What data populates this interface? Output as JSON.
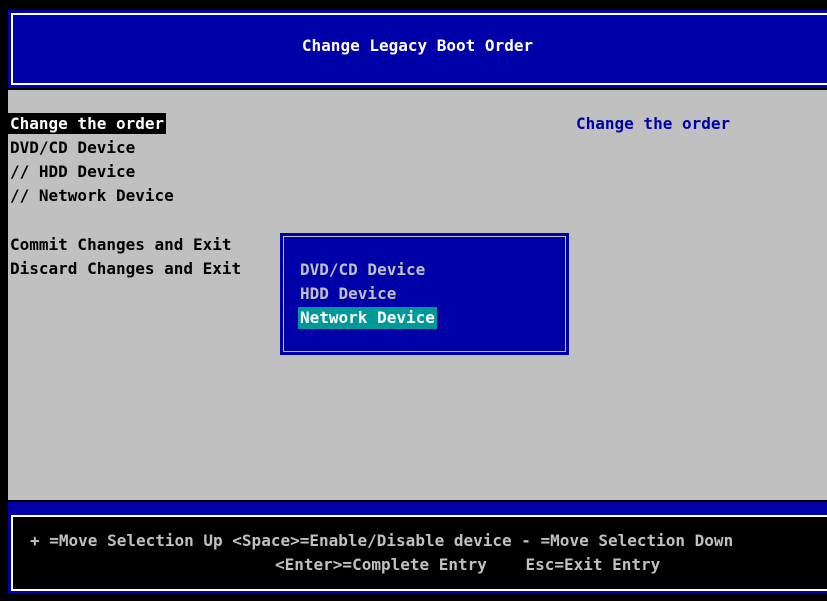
{
  "title": "Change Legacy Boot Order",
  "menu": {
    "change_order": "Change the order",
    "device_list": [
      "DVD/CD Device",
      "// HDD Device",
      "// Network Device"
    ],
    "commit": "Commit Changes and Exit",
    "discard": "Discard Changes and Exit"
  },
  "help_text": "Change the order",
  "popup": {
    "items": [
      "DVD/CD Device",
      "HDD Device",
      "Network Device"
    ],
    "selected_index": 2
  },
  "footer": {
    "line1": "+ =Move Selection Up <Space>=Enable/Disable device - =Move Selection Down",
    "line2": "<Enter>=Complete Entry    Esc=Exit Entry"
  },
  "colors": {
    "bios_blue": "#0000a8",
    "panel_grey": "#c0c0c0",
    "popup_highlight": "#009999",
    "help_text": "#0000a8"
  }
}
